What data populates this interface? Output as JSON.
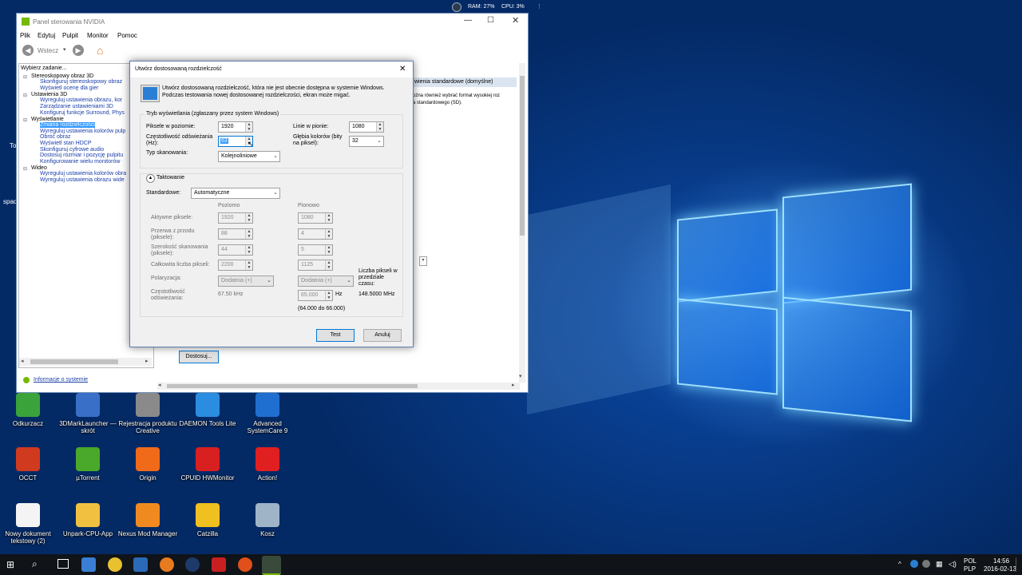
{
  "tray_top": {
    "ram": "RAM: 27%",
    "cpu": "CPU: 3%"
  },
  "nvidia": {
    "title": "Panel sterowania NVIDIA",
    "menu": [
      "Plik",
      "Edytuj",
      "Pulpit",
      "Monitor",
      "Pomoc"
    ],
    "back_label": "Wstecz",
    "task_label": "Wybierz zadanie...",
    "tree": [
      {
        "text": "Stereoskopowy obraz 3D",
        "level": 0
      },
      {
        "text": "Skonfiguruj stereoskopowy obraz",
        "level": 1
      },
      {
        "text": "Wyświetl ocenę dla gier",
        "level": 1
      },
      {
        "text": "Ustawienia 3D",
        "level": 0
      },
      {
        "text": "Wyreguluj ustawienia obrazu, kor",
        "level": 1
      },
      {
        "text": "Zarządzanie ustawieniami 3D",
        "level": 1
      },
      {
        "text": "Konfiguruj funkcje Surround, Phys",
        "level": 1
      },
      {
        "text": "Wyświetlanie",
        "level": 0
      },
      {
        "text": "Zmiana rozdzielczości",
        "level": 1,
        "selected": true
      },
      {
        "text": "Wyreguluj ustawienia kolorów pulp",
        "level": 1
      },
      {
        "text": "Obróć obraz",
        "level": 1
      },
      {
        "text": "Wyświetl stan HDCP",
        "level": 1
      },
      {
        "text": "Skonfiguruj cyfrowe audio",
        "level": 1
      },
      {
        "text": "Dostosuj rozmiar i pozycję pulpitu",
        "level": 1
      },
      {
        "text": "Konfigurowanie wielu monitorów",
        "level": 1
      },
      {
        "text": "Wideo",
        "level": 0
      },
      {
        "text": "Wyreguluj ustawienia kolorów obra",
        "level": 1
      },
      {
        "text": "Wyreguluj ustawienia obrazu wide",
        "level": 1
      }
    ],
    "system_info": "Informacje o systemie",
    "right_header": "wienia standardowe (domyślne)",
    "right_text1": "ożna również wybrać format wysokiej roz",
    "right_text2": "a standardowego (SD).",
    "customize_button": "Dostosuj..."
  },
  "dialog": {
    "title": "Utwórz dostosowaną rozdzielczość",
    "desc1": "Utwórz dostosowaną rozdzielczość, która nie jest obecnie dostępna w systemie Windows.",
    "desc2": "Podczas testowania nowej dostosowanej rozdzielczości, ekran może migać.",
    "mode_group": "Tryb wyświetlania (zgłaszany przez system Windows)",
    "h_pixels_label": "Piksele w poziomie:",
    "h_pixels": "1920",
    "v_lines_label": "Linie w pionie:",
    "v_lines": "1080",
    "refresh_label1": "Częstotliwość odświeżania",
    "refresh_label2": "(Hz):",
    "refresh_value": "63",
    "color_depth_label1": "Głębia kolorów (bity",
    "color_depth_label2": "na piksel):",
    "color_depth": "32",
    "scan_label": "Typ skanowania:",
    "scan_value": "Kolejnoliniowe",
    "timing_label": "Taktowanie",
    "standard_label": "Standardowe:",
    "standard_value": "Automatyczne",
    "col_h": "Poziomo",
    "col_v": "Pionowo",
    "rows": [
      {
        "label1": "Aktywne piksele:",
        "label2": "",
        "h": "1920",
        "v": "1080"
      },
      {
        "label1": "Przerwa z przodu",
        "label2": "(piksele):",
        "h": "88",
        "v": "4"
      },
      {
        "label1": "Szerokość skanowania",
        "label2": "(piksele):",
        "h": "44",
        "v": "5"
      },
      {
        "label1": "Całkowita liczba pikseli:",
        "label2": "",
        "h": "2200",
        "v": "1125"
      }
    ],
    "polarity_label": "Polaryzacja:",
    "polarity_h": "Dodatnia (+)",
    "polarity_v": "Dodatnia (+)",
    "freq_label1": "Częstotliwość",
    "freq_label2": "odświeżania:",
    "freq_h": "67.50 kHz",
    "freq_v": "65.000",
    "freq_v_unit": "Hz",
    "freq_range": "(64.000 do 66.000)",
    "pixclock_label1": "Liczba pikseli w",
    "pixclock_label2": "przedziale",
    "pixclock_label3": "czasu:",
    "pixclock_value": "148.5000 MHz",
    "test_button": "Test",
    "cancel_button": "Anuluj"
  },
  "desktop_icons": [
    {
      "label": "Odkurzacz",
      "color": "#3aa33a"
    },
    {
      "label": "3DMarkLauncher — skrót",
      "color": "#3a6fc8"
    },
    {
      "label": "Rejestracja produktu Creative",
      "color": "#8a8a8a"
    },
    {
      "label": "DAEMON Tools Lite",
      "color": "#2a8de0"
    },
    {
      "label": "Advanced SystemCare 9",
      "color": "#1f6fd0"
    },
    {
      "label": "OCCT",
      "color": "#d03a1f"
    },
    {
      "label": "µTorrent",
      "color": "#4aa82a"
    },
    {
      "label": "Origin",
      "color": "#f06a1a"
    },
    {
      "label": "CPUID HWMonitor",
      "color": "#d82020"
    },
    {
      "label": "Action!",
      "color": "#e02020"
    },
    {
      "label": "Nowy dokument tekstowy (2)",
      "color": "#f4f4f4"
    },
    {
      "label": "Unpark-CPU-App",
      "color": "#f2c040"
    },
    {
      "label": "Nexus Mod Manager",
      "color": "#f08a20"
    },
    {
      "label": "Catzilla",
      "color": "#f0c020"
    },
    {
      "label": "Kosz",
      "color": "#a0b4c8"
    }
  ],
  "desktop_partial": {
    "left1": "To",
    "left2": "spad"
  },
  "taskbar": {
    "lang1": "POL",
    "lang2": "PLP",
    "time": "14:56",
    "date": "2016-02-13"
  }
}
